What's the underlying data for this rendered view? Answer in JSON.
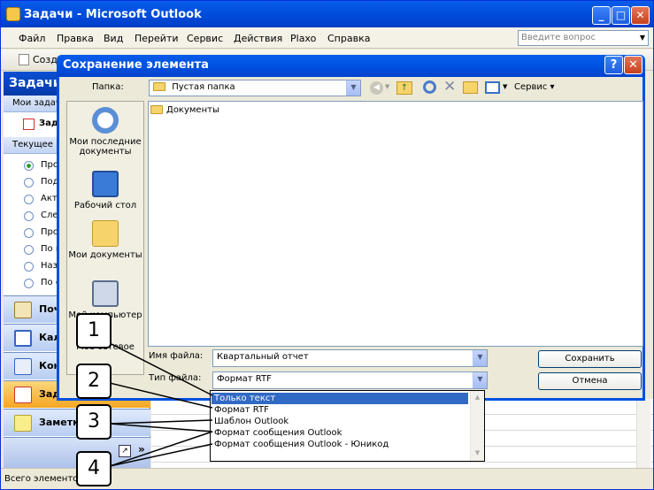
{
  "outlook": {
    "title": "Задачи - Microsoft Outlook",
    "menu": [
      "Файл",
      "Правка",
      "Вид",
      "Перейти",
      "Сервис",
      "Действия",
      "Plaxo",
      "Справка"
    ],
    "ask_placeholder": "Введите вопрос",
    "toolbar_create": "Созда",
    "nav_title": "Задачи",
    "my_tasks": "Мои задачи",
    "task_item": "Зада",
    "current_view": "Текущее п",
    "views": [
      "Про",
      "Под",
      "Акт",
      "Сле",
      "Про",
      "По к",
      "Назн",
      "По с"
    ],
    "modules": [
      "Почта",
      "Календарь",
      "Контакты",
      "Задачи",
      "Заметки"
    ],
    "status": "Всего элементов"
  },
  "dialog": {
    "title": "Сохранение элемента",
    "folder_label": "Папка:",
    "folder_value": "Пустая папка",
    "tools_label": "Сервис",
    "places": [
      "Мои последние документы",
      "Рабочий стол",
      "Мои документы",
      "Мой компьютер",
      "Мое сетевое"
    ],
    "files": [
      "Документы"
    ],
    "filename_label": "Имя файла:",
    "filename_value": "Квартальный отчет",
    "filetype_label": "Тип файла:",
    "filetype_value": "Формат RTF",
    "save_button": "Сохранить",
    "cancel_button": "Отмена",
    "type_options": [
      "Только текст",
      "Формат RTF",
      "Шаблон Outlook",
      "Формат сообщения Outlook",
      "Формат сообщения Outlook - Юникод"
    ],
    "selected_option": "Только текст"
  },
  "callouts": [
    "1",
    "2",
    "3",
    "4"
  ]
}
